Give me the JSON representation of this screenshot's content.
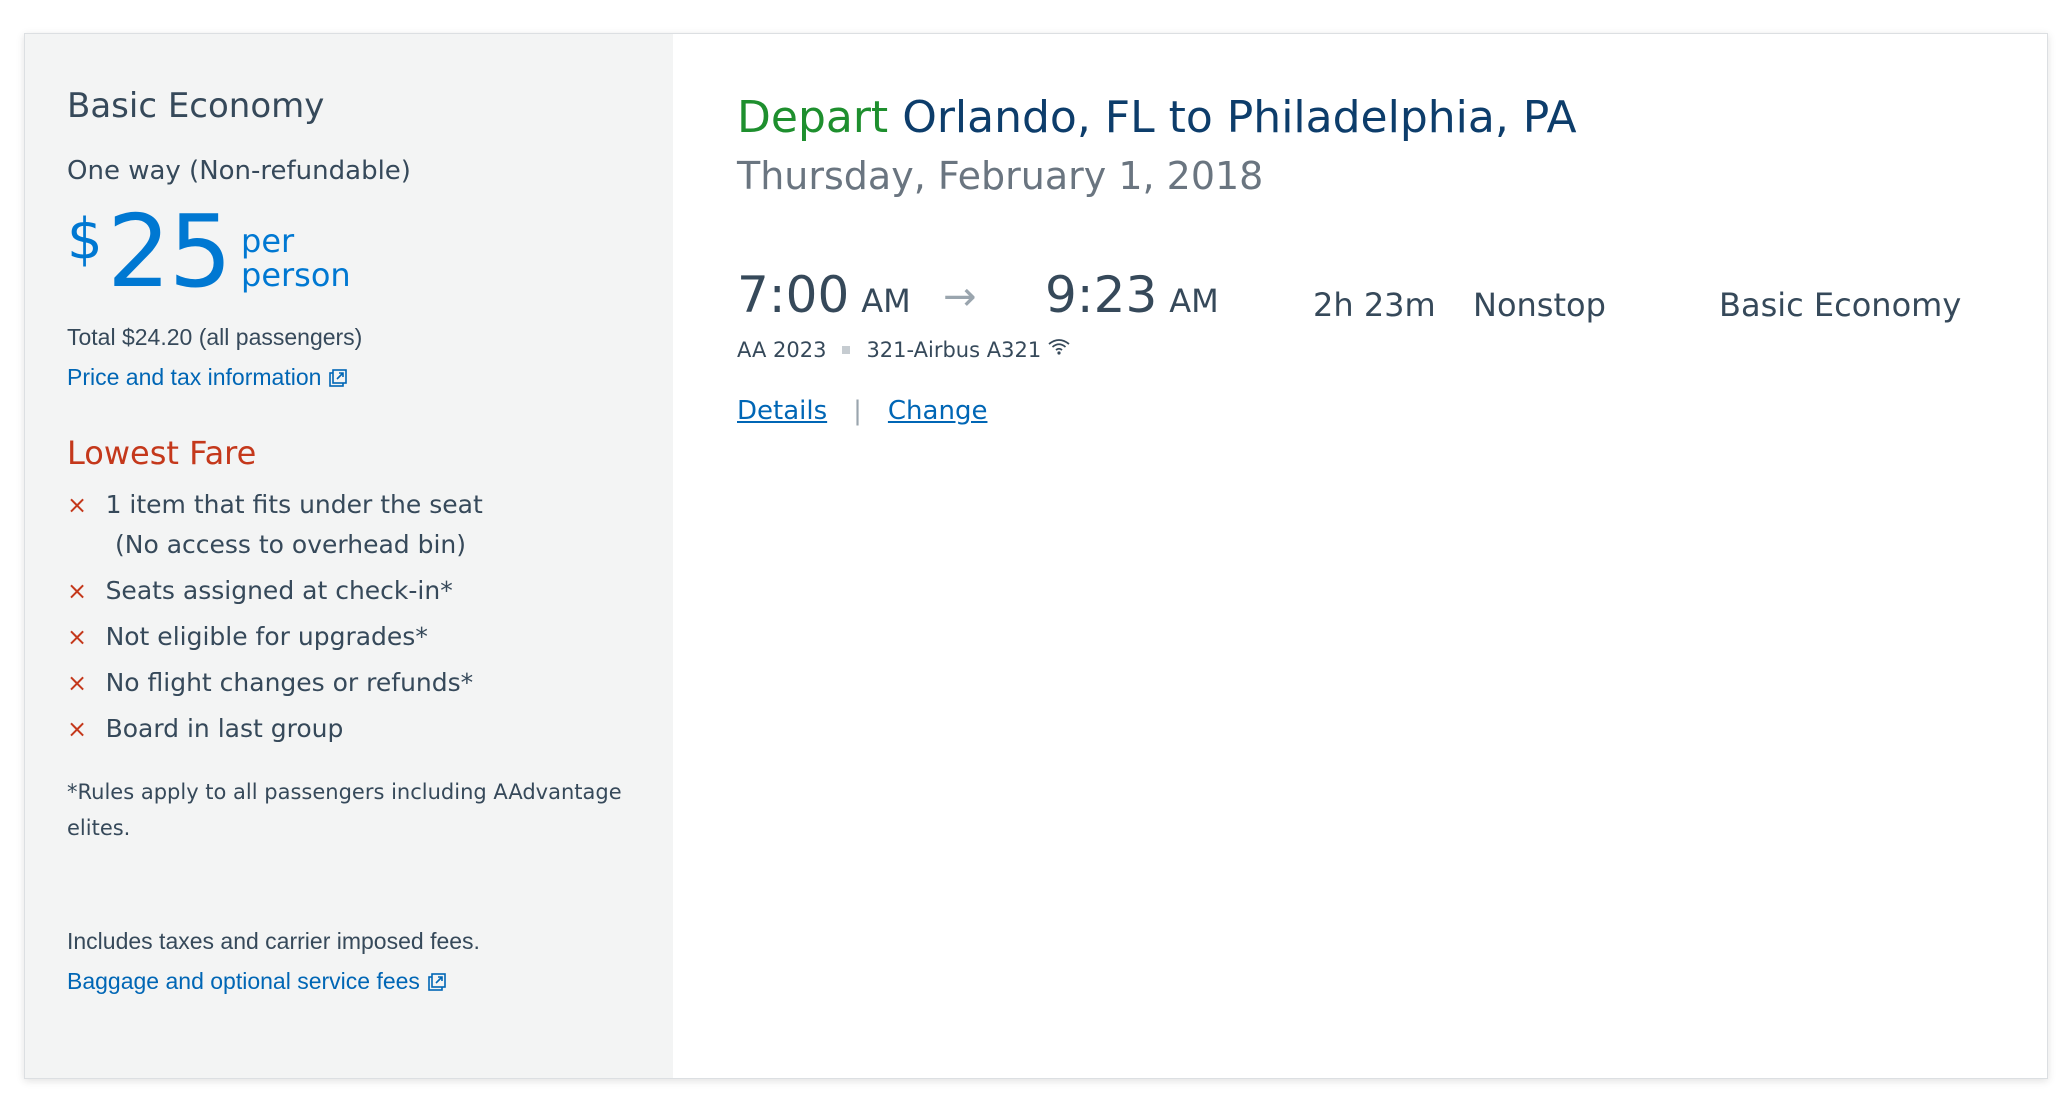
{
  "fare": {
    "name": "Basic Economy",
    "trip_type": "One way (Non-refundable)",
    "currency_symbol": "$",
    "price": "25",
    "per_label_1": "per",
    "per_label_2": "person",
    "total": "Total $24.20 (all passengers)",
    "price_tax_link": "Price and tax information"
  },
  "lowest_fare": {
    "heading": "Lowest Fare",
    "rules": [
      {
        "text": "1 item that fits under the seat",
        "sub": "(No access to overhead bin)"
      },
      {
        "text": "Seats assigned at check-in*"
      },
      {
        "text": "Not eligible for upgrades*"
      },
      {
        "text": "No flight changes or refunds*"
      },
      {
        "text": "Board in last group"
      }
    ],
    "rule_marker": "×",
    "footnote": "*Rules apply to all passengers including AAdvantage elites."
  },
  "fees": {
    "includes_text": "Includes taxes and carrier imposed fees.",
    "baggage_link": "Baggage and optional service fees"
  },
  "flight": {
    "depart_word": "Depart",
    "route": "Orlando, FL to Philadelphia, PA",
    "date": "Thursday, February 1, 2018",
    "depart_time": "7:00",
    "depart_ampm": "AM",
    "arrow": "→",
    "arrive_time": "9:23",
    "arrive_ampm": "AM",
    "duration": "2h  23m",
    "stops": "Nonstop",
    "cabin": "Basic Economy",
    "flight_number": "AA 2023",
    "aircraft": "321-Airbus A321",
    "details_link": "Details",
    "separator": "|",
    "change_link": "Change"
  },
  "icons": {
    "external_link": "external-link-icon",
    "wifi": "wifi-icon",
    "rule_x": "x-icon"
  },
  "colors": {
    "accent_blue": "#0078d2",
    "link_blue": "#0066b5",
    "depart_green": "#1e8f2e",
    "route_navy": "#0d3d6b",
    "warning_red": "#c4381b",
    "sidebar_bg": "#f3f4f4"
  }
}
